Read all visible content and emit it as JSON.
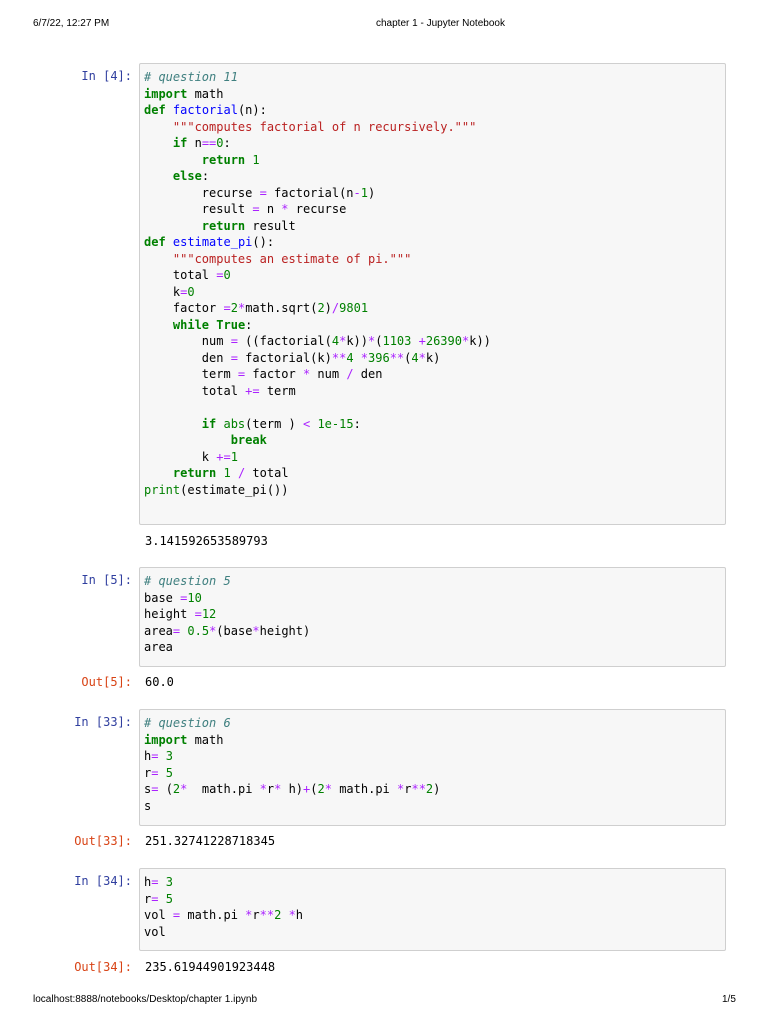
{
  "header": {
    "datetime": "6/7/22, 12:27 PM",
    "title": "chapter 1 - Jupyter Notebook"
  },
  "footer": {
    "url": "localhost:8888/notebooks/Desktop/chapter 1.ipynb",
    "page": "1/5"
  },
  "cells": [
    {
      "prompt": "In [4]:",
      "out_prompt": "",
      "output": "3.141592653589793",
      "code": [
        [
          [
            "c",
            "# question 11"
          ]
        ],
        [
          [
            "k",
            "import"
          ],
          [
            "n",
            " math"
          ]
        ],
        [
          [
            "k",
            "def"
          ],
          [
            "n",
            " "
          ],
          [
            "f",
            "factorial"
          ],
          [
            "n",
            "(n):"
          ]
        ],
        [
          [
            "n",
            "    "
          ],
          [
            "s",
            "\"\"\"computes factorial of n recursively.\"\"\""
          ]
        ],
        [
          [
            "n",
            "    "
          ],
          [
            "k",
            "if"
          ],
          [
            "n",
            " n"
          ],
          [
            "o",
            "=="
          ],
          [
            "m",
            "0"
          ],
          [
            "n",
            ":"
          ]
        ],
        [
          [
            "n",
            "        "
          ],
          [
            "k",
            "return"
          ],
          [
            "n",
            " "
          ],
          [
            "m",
            "1"
          ]
        ],
        [
          [
            "n",
            "    "
          ],
          [
            "k",
            "else"
          ],
          [
            "n",
            ":"
          ]
        ],
        [
          [
            "n",
            "        recurse "
          ],
          [
            "o",
            "="
          ],
          [
            "n",
            " factorial(n"
          ],
          [
            "o",
            "-"
          ],
          [
            "m",
            "1"
          ],
          [
            "n",
            ")"
          ]
        ],
        [
          [
            "n",
            "        result "
          ],
          [
            "o",
            "="
          ],
          [
            "n",
            " n "
          ],
          [
            "o",
            "*"
          ],
          [
            "n",
            " recurse"
          ]
        ],
        [
          [
            "n",
            "        "
          ],
          [
            "k",
            "return"
          ],
          [
            "n",
            " result"
          ]
        ],
        [
          [
            "k",
            "def"
          ],
          [
            "n",
            " "
          ],
          [
            "f",
            "estimate_pi"
          ],
          [
            "n",
            "():"
          ]
        ],
        [
          [
            "n",
            "    "
          ],
          [
            "s",
            "\"\"\"computes an estimate of pi.\"\"\""
          ]
        ],
        [
          [
            "n",
            "    total "
          ],
          [
            "o",
            "="
          ],
          [
            "m",
            "0"
          ]
        ],
        [
          [
            "n",
            "    k"
          ],
          [
            "o",
            "="
          ],
          [
            "m",
            "0"
          ]
        ],
        [
          [
            "n",
            "    factor "
          ],
          [
            "o",
            "="
          ],
          [
            "m",
            "2"
          ],
          [
            "o",
            "*"
          ],
          [
            "n",
            "math.sqrt("
          ],
          [
            "m",
            "2"
          ],
          [
            "n",
            ")"
          ],
          [
            "o",
            "/"
          ],
          [
            "m",
            "9801"
          ]
        ],
        [
          [
            "n",
            "    "
          ],
          [
            "k",
            "while"
          ],
          [
            "n",
            " "
          ],
          [
            "k",
            "True"
          ],
          [
            "n",
            ":"
          ]
        ],
        [
          [
            "n",
            "        num "
          ],
          [
            "o",
            "="
          ],
          [
            "n",
            " ((factorial("
          ],
          [
            "m",
            "4"
          ],
          [
            "o",
            "*"
          ],
          [
            "n",
            "k))"
          ],
          [
            "o",
            "*"
          ],
          [
            "n",
            "("
          ],
          [
            "m",
            "1103"
          ],
          [
            "n",
            " "
          ],
          [
            "o",
            "+"
          ],
          [
            "m",
            "26390"
          ],
          [
            "o",
            "*"
          ],
          [
            "n",
            "k))"
          ]
        ],
        [
          [
            "n",
            "        den "
          ],
          [
            "o",
            "="
          ],
          [
            "n",
            " factorial(k)"
          ],
          [
            "o",
            "**"
          ],
          [
            "m",
            "4"
          ],
          [
            "n",
            " "
          ],
          [
            "o",
            "*"
          ],
          [
            "m",
            "396"
          ],
          [
            "o",
            "**"
          ],
          [
            "n",
            "("
          ],
          [
            "m",
            "4"
          ],
          [
            "o",
            "*"
          ],
          [
            "n",
            "k)"
          ]
        ],
        [
          [
            "n",
            "        term "
          ],
          [
            "o",
            "="
          ],
          [
            "n",
            " factor "
          ],
          [
            "o",
            "*"
          ],
          [
            "n",
            " num "
          ],
          [
            "o",
            "/"
          ],
          [
            "n",
            " den"
          ]
        ],
        [
          [
            "n",
            "        total "
          ],
          [
            "o",
            "+="
          ],
          [
            "n",
            " term"
          ]
        ],
        [
          [
            "n",
            ""
          ]
        ],
        [
          [
            "n",
            "        "
          ],
          [
            "k",
            "if"
          ],
          [
            "n",
            " "
          ],
          [
            "b",
            "abs"
          ],
          [
            "n",
            "(term ) "
          ],
          [
            "o",
            "<"
          ],
          [
            "n",
            " "
          ],
          [
            "m",
            "1e-15"
          ],
          [
            "n",
            ":"
          ]
        ],
        [
          [
            "n",
            "            "
          ],
          [
            "k",
            "break"
          ]
        ],
        [
          [
            "n",
            "        k "
          ],
          [
            "o",
            "+="
          ],
          [
            "m",
            "1"
          ]
        ],
        [
          [
            "n",
            "    "
          ],
          [
            "k",
            "return"
          ],
          [
            "n",
            " "
          ],
          [
            "m",
            "1"
          ],
          [
            "n",
            " "
          ],
          [
            "o",
            "/"
          ],
          [
            "n",
            " total"
          ]
        ],
        [
          [
            "b",
            "print"
          ],
          [
            "n",
            "(estimate_pi())"
          ]
        ]
      ]
    },
    {
      "prompt": "In [5]:",
      "out_prompt": "Out[5]:",
      "output": "60.0",
      "code": [
        [
          [
            "c",
            "# question 5"
          ]
        ],
        [
          [
            "n",
            "base "
          ],
          [
            "o",
            "="
          ],
          [
            "m",
            "10"
          ]
        ],
        [
          [
            "n",
            "height "
          ],
          [
            "o",
            "="
          ],
          [
            "m",
            "12"
          ]
        ],
        [
          [
            "n",
            "area"
          ],
          [
            "o",
            "="
          ],
          [
            "n",
            " "
          ],
          [
            "m",
            "0.5"
          ],
          [
            "o",
            "*"
          ],
          [
            "n",
            "(base"
          ],
          [
            "o",
            "*"
          ],
          [
            "n",
            "height)"
          ]
        ],
        [
          [
            "n",
            "area"
          ]
        ]
      ]
    },
    {
      "prompt": "In [33]:",
      "out_prompt": "Out[33]:",
      "output": "251.32741228718345",
      "code": [
        [
          [
            "c",
            "# question 6"
          ]
        ],
        [
          [
            "k",
            "import"
          ],
          [
            "n",
            " math"
          ]
        ],
        [
          [
            "n",
            "h"
          ],
          [
            "o",
            "="
          ],
          [
            "n",
            " "
          ],
          [
            "m",
            "3"
          ]
        ],
        [
          [
            "n",
            "r"
          ],
          [
            "o",
            "="
          ],
          [
            "n",
            " "
          ],
          [
            "m",
            "5"
          ]
        ],
        [
          [
            "n",
            "s"
          ],
          [
            "o",
            "="
          ],
          [
            "n",
            " ("
          ],
          [
            "m",
            "2"
          ],
          [
            "o",
            "*"
          ],
          [
            "n",
            "  math.pi "
          ],
          [
            "o",
            "*"
          ],
          [
            "n",
            "r"
          ],
          [
            "o",
            "*"
          ],
          [
            "n",
            " h)"
          ],
          [
            "o",
            "+"
          ],
          [
            "n",
            "("
          ],
          [
            "m",
            "2"
          ],
          [
            "o",
            "*"
          ],
          [
            "n",
            " math.pi "
          ],
          [
            "o",
            "*"
          ],
          [
            "n",
            "r"
          ],
          [
            "o",
            "**"
          ],
          [
            "m",
            "2"
          ],
          [
            "n",
            ")"
          ]
        ],
        [
          [
            "n",
            "s"
          ]
        ]
      ]
    },
    {
      "prompt": "In [34]:",
      "out_prompt": "Out[34]:",
      "output": "235.61944901923448",
      "code": [
        [
          [
            "n",
            "h"
          ],
          [
            "o",
            "="
          ],
          [
            "n",
            " "
          ],
          [
            "m",
            "3"
          ]
        ],
        [
          [
            "n",
            "r"
          ],
          [
            "o",
            "="
          ],
          [
            "n",
            " "
          ],
          [
            "m",
            "5"
          ]
        ],
        [
          [
            "n",
            "vol "
          ],
          [
            "o",
            "="
          ],
          [
            "n",
            " math.pi "
          ],
          [
            "o",
            "*"
          ],
          [
            "n",
            "r"
          ],
          [
            "o",
            "**"
          ],
          [
            "m",
            "2"
          ],
          [
            "n",
            " "
          ],
          [
            "o",
            "*"
          ],
          [
            "n",
            "h"
          ]
        ],
        [
          [
            "n",
            "vol"
          ]
        ]
      ]
    }
  ]
}
